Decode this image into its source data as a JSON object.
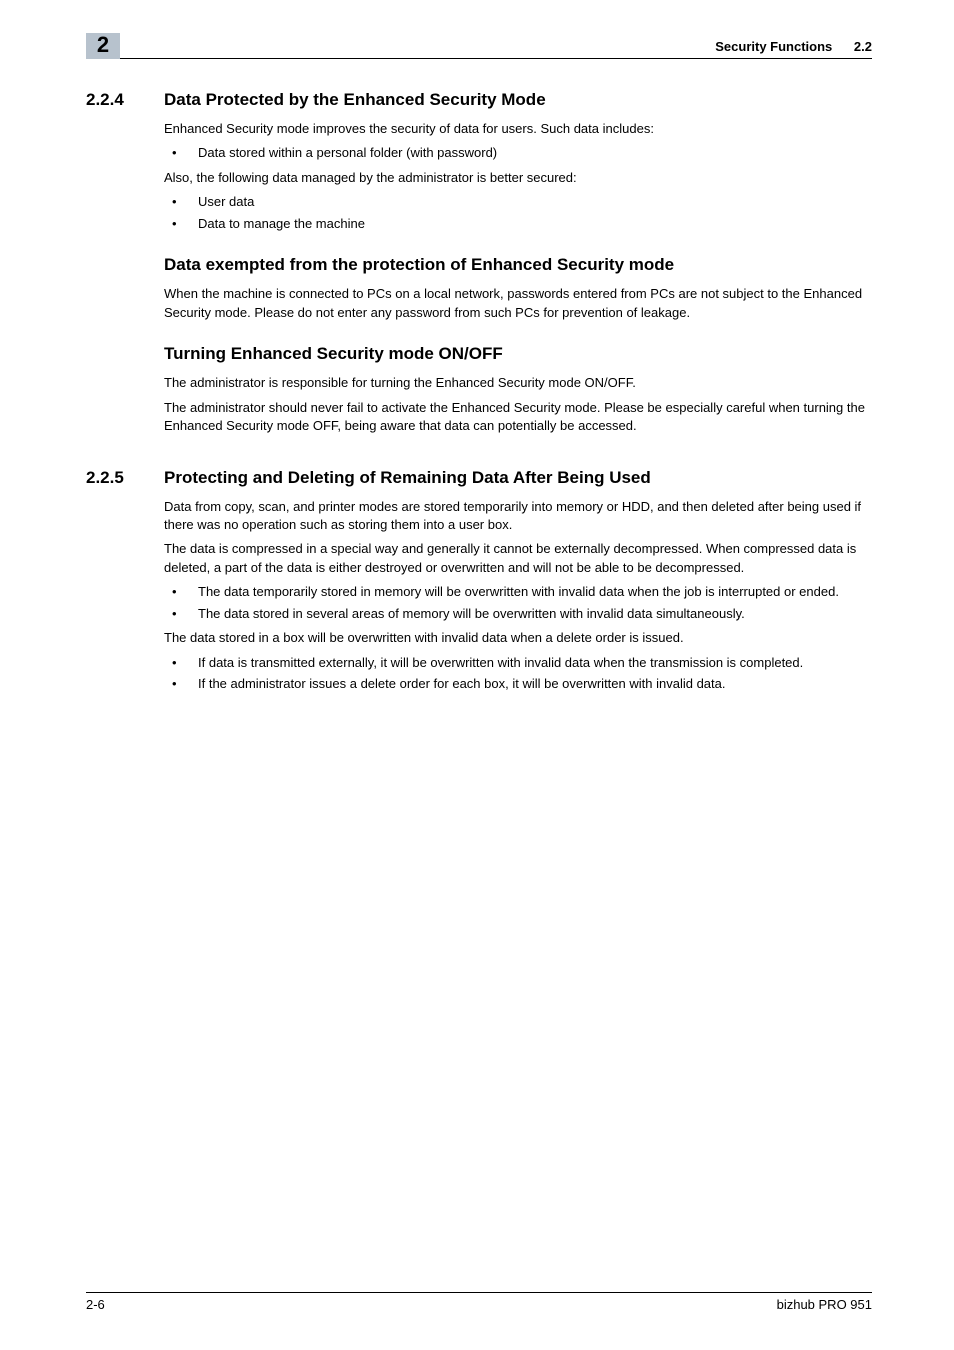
{
  "header": {
    "chapter_tab": "2",
    "title": "Security Functions",
    "section_number": "2.2"
  },
  "sections": [
    {
      "number": "2.2.4",
      "title": "Data Protected by the Enhanced Security Mode",
      "intro": "Enhanced Security mode improves the security of data for users. Such data includes:",
      "bullets1": [
        "Data stored within a personal folder (with password)"
      ],
      "after1": "Also, the following data managed by the administrator is better secured:",
      "bullets2": [
        "User data",
        "Data to manage the machine"
      ],
      "subsections": [
        {
          "title": "Data exempted from the protection of Enhanced Security mode",
          "paragraphs": [
            "When the machine is connected to PCs on a local network, passwords entered from PCs are not subject to the Enhanced Security mode. Please do not enter any password from such PCs for prevention of leakage."
          ]
        },
        {
          "title": "Turning Enhanced Security mode ON/OFF",
          "paragraphs": [
            "The administrator is responsible for turning the Enhanced Security mode ON/OFF.",
            "The administrator should never fail to activate the Enhanced Security mode. Please be especially careful when turning the Enhanced Security mode OFF, being aware that data can potentially be accessed."
          ]
        }
      ]
    },
    {
      "number": "2.2.5",
      "title": "Protecting and Deleting of Remaining Data After Being Used",
      "paragraphs": [
        "Data from copy, scan, and printer modes are stored temporarily into memory or HDD, and then deleted after being used if there was no operation such as storing them into a user box.",
        "The data is compressed in a special way and generally it cannot be externally decompressed. When compressed data is deleted, a part of the data is either destroyed or overwritten and will not be able to be decompressed."
      ],
      "bullets1": [
        "The data temporarily stored in memory will be overwritten with invalid data when the job is interrupted or ended.",
        "The data stored in several areas of memory will be overwritten with invalid data simultaneously."
      ],
      "after1": "The data stored in a box will be overwritten with invalid data when a delete order is issued.",
      "bullets2": [
        "If data is transmitted externally, it will be overwritten with invalid data when the transmission is completed.",
        "If the administrator issues a delete order for each box, it will be overwritten with invalid data."
      ]
    }
  ],
  "footer": {
    "page": "2-6",
    "product": "bizhub PRO 951"
  }
}
